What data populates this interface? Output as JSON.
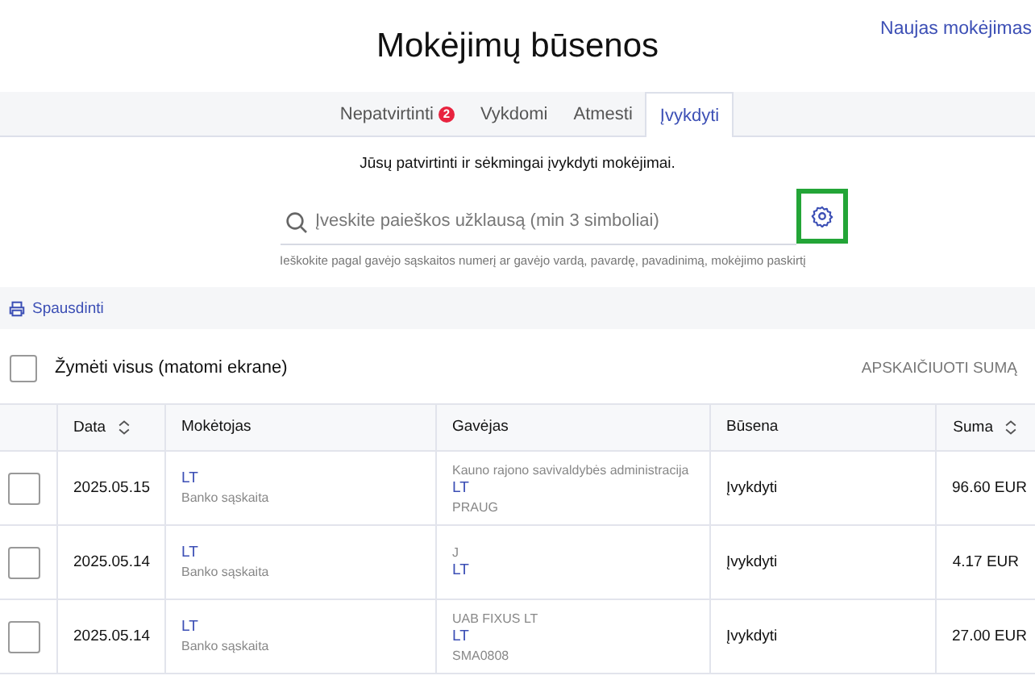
{
  "header": {
    "title": "Mokėjimų būsenos",
    "new_payment_link": "Naujas mokėjimas"
  },
  "tabs": [
    {
      "label": "Nepatvirtinti",
      "badge": "2",
      "selected": false
    },
    {
      "label": "Vykdomi",
      "selected": false
    },
    {
      "label": "Atmesti",
      "selected": false
    },
    {
      "label": "Įvykdyti",
      "selected": true
    }
  ],
  "description": "Jūsų patvirtinti ir sėkmingai įvykdyti mokėjimai.",
  "search": {
    "placeholder": "Įveskite paieškos užklausą (min 3 simboliai)",
    "hint": "Ieškokite pagal gavėjo sąskaitos numerį ar gavėjo vardą, pavardę, pavadinimą, mokėjimo paskirtį"
  },
  "print_link": "Spausdinti",
  "select_all": {
    "label": "Žymėti visus (matomi ekrane)",
    "checked": false
  },
  "calculate_button": "APSKAIČIUOTI SUMĄ",
  "table": {
    "columns": [
      {
        "label": "Data",
        "sortable": true
      },
      {
        "label": "Mokėtojas",
        "sortable": false
      },
      {
        "label": "Gavėjas",
        "sortable": false
      },
      {
        "label": "Būsena",
        "sortable": false
      },
      {
        "label": "Suma",
        "sortable": true
      }
    ],
    "rows": [
      {
        "checked": false,
        "date": "2025.05.15",
        "payer_account": "LT",
        "payer_type": "Banko sąskaita",
        "payee_name": "Kauno rajono savivaldybės administracija",
        "payee_account": "LT",
        "payee_code": "PRAUG",
        "status": "Įvykdyti",
        "amount": "96.60 EUR"
      },
      {
        "checked": false,
        "date": "2025.05.14",
        "payer_account": "LT",
        "payer_type": "Banko sąskaita",
        "payee_name": "J",
        "payee_account": "LT",
        "status": "Įvykdyti",
        "amount": "4.17 EUR"
      },
      {
        "checked": false,
        "date": "2025.05.14",
        "payer_account": "LT",
        "payer_type": "Banko sąskaita",
        "payee_name": "UAB FIXUS LT",
        "payee_account": "LT",
        "payee_code": "SMA0808",
        "status": "Įvykdyti",
        "amount": "27.00 EUR"
      }
    ]
  }
}
